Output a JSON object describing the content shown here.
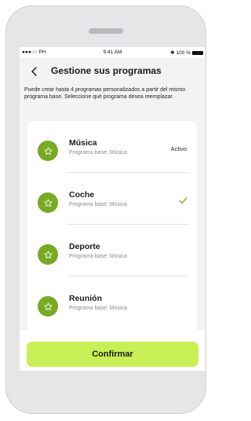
{
  "statusbar": {
    "carrier": "●●●○○ PH",
    "time": "9:41 AM",
    "battery_text": "100 %"
  },
  "header": {
    "title": "Gestione sus programas"
  },
  "intro": "Puede crear hasta 4 programas personalizados a partir del mismo programa base. Seleccione qué programa desea reemplazar.",
  "programs": [
    {
      "name": "Música",
      "base": "Programa base: Música",
      "status": "Activo",
      "selected": false
    },
    {
      "name": "Coche",
      "base": "Programa base: Música",
      "status": "",
      "selected": true
    },
    {
      "name": "Deporte",
      "base": "Programa base: Música",
      "status": "",
      "selected": false
    },
    {
      "name": "Reunión",
      "base": "Programa base: Música",
      "status": "",
      "selected": false
    }
  ],
  "footer": {
    "confirm_label": "Confirmar"
  },
  "colors": {
    "accent": "#c8ef55",
    "icon_circle": "#7aa923",
    "check": "#7aa923"
  },
  "icons": {
    "back": "chevron-left-icon",
    "program": "star-icon",
    "selected": "checkmark-icon"
  }
}
